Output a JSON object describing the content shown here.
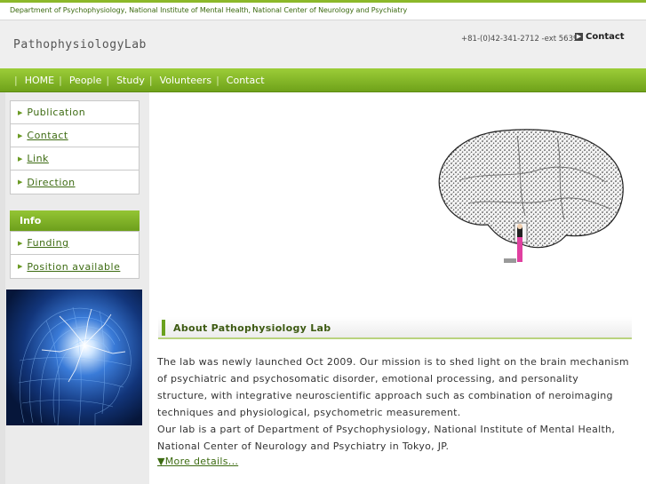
{
  "topbar": {
    "department": "Department of Psychophysiology, National Institute of Mental Health, National Center of Neurology and Psychiatry"
  },
  "header": {
    "logo": "PathophysiologyLab",
    "phone": "+81-(0)42-341-2712 -ext 5639",
    "contact_label": "Contact"
  },
  "nav": {
    "items": [
      "HOME",
      "People",
      "Study",
      "Volunteers",
      "Contact"
    ]
  },
  "sidebar": {
    "menu1": [
      "Publication",
      "Contact",
      "Link",
      "Direction"
    ],
    "info_title": "Info",
    "menu2": [
      "Funding",
      "Position available"
    ]
  },
  "about": {
    "title": "About Pathophysiology Lab",
    "lines": [
      "The lab was newly launched Oct 2009. Our mission is to shed light on the brain mechanism",
      "of psychiatric and psychosomatic disorder, emotional processing, and personality",
      "structure, with integrative neuroscientific approach such as combination of neroimaging",
      "techniques and physiological, psychometric measurement.",
      "Our lab is a part of Department of Psychophysiology, National Institute of Mental Health,",
      "National Center of Neurology and Psychiatry in Tokyo, JP."
    ],
    "more": "▼More details..."
  },
  "colors": {
    "accent": "#7bb02a",
    "link": "#3d6b12"
  }
}
